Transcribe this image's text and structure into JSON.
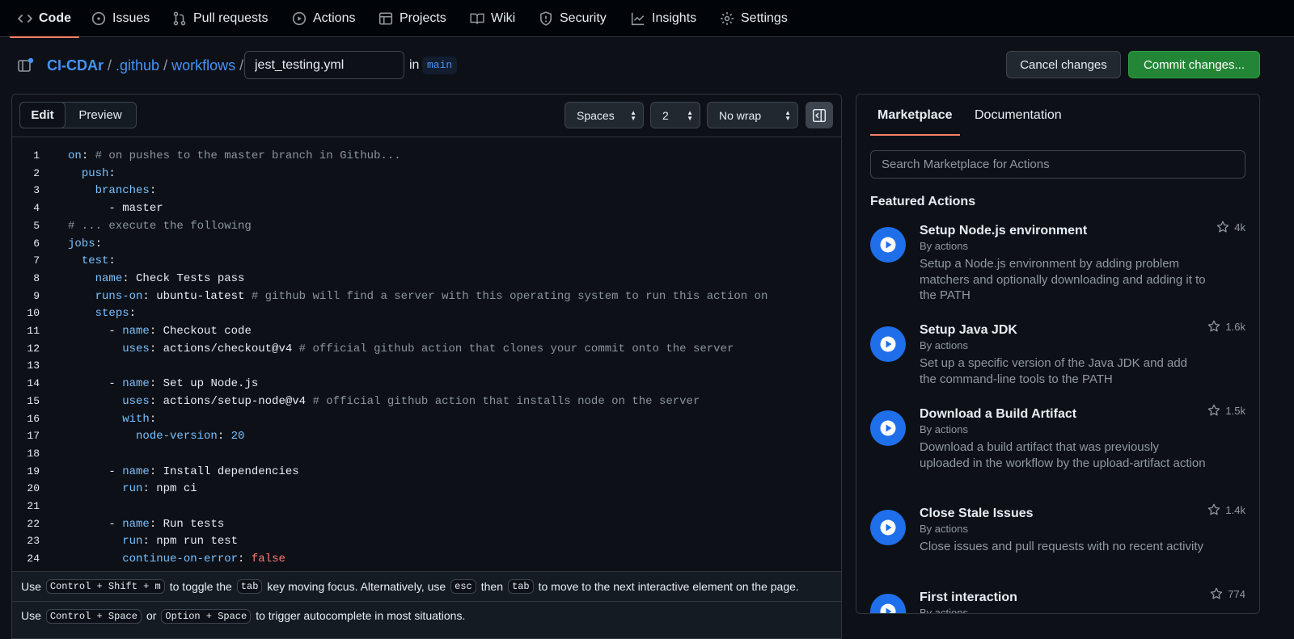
{
  "nav": {
    "items": [
      {
        "label": "Code",
        "icon": "code-icon"
      },
      {
        "label": "Issues",
        "icon": "issue-icon"
      },
      {
        "label": "Pull requests",
        "icon": "pull-request-icon"
      },
      {
        "label": "Actions",
        "icon": "play-icon"
      },
      {
        "label": "Projects",
        "icon": "table-icon"
      },
      {
        "label": "Wiki",
        "icon": "book-icon"
      },
      {
        "label": "Security",
        "icon": "shield-icon"
      },
      {
        "label": "Insights",
        "icon": "graph-icon"
      },
      {
        "label": "Settings",
        "icon": "gear-icon"
      }
    ]
  },
  "breadcrumb": {
    "repo": "CI-CDAr",
    "dir1": ".github",
    "dir2": "workflows",
    "sep": "/",
    "filename": "jest_testing.yml",
    "in_label": "in",
    "branch": "main"
  },
  "buttons": {
    "cancel": "Cancel changes",
    "commit": "Commit changes..."
  },
  "editor": {
    "tabs": {
      "edit": "Edit",
      "preview": "Preview"
    },
    "indent_mode": "Spaces",
    "indent_size": "2",
    "wrap_mode": "No wrap",
    "lines": [
      [
        [
          "k",
          "on"
        ],
        [
          "p",
          ": "
        ],
        [
          "c",
          "# on pushes to the master branch in Github..."
        ]
      ],
      [
        [
          "p",
          "  "
        ],
        [
          "k",
          "push"
        ],
        [
          "p",
          ":"
        ]
      ],
      [
        [
          "p",
          "    "
        ],
        [
          "k",
          "branches"
        ],
        [
          "p",
          ":"
        ]
      ],
      [
        [
          "p",
          "      - master"
        ]
      ],
      [
        [
          "c",
          "# ... execute the following"
        ]
      ],
      [
        [
          "k",
          "jobs"
        ],
        [
          "p",
          ":"
        ]
      ],
      [
        [
          "p",
          "  "
        ],
        [
          "k",
          "test"
        ],
        [
          "p",
          ":"
        ]
      ],
      [
        [
          "p",
          "    "
        ],
        [
          "k",
          "name"
        ],
        [
          "p",
          ": Check Tests pass"
        ]
      ],
      [
        [
          "p",
          "    "
        ],
        [
          "k",
          "runs-on"
        ],
        [
          "p",
          ": ubuntu-latest "
        ],
        [
          "c",
          "# github will find a server with this operating system to run this action on"
        ]
      ],
      [
        [
          "p",
          "    "
        ],
        [
          "k",
          "steps"
        ],
        [
          "p",
          ":"
        ]
      ],
      [
        [
          "p",
          "      - "
        ],
        [
          "k",
          "name"
        ],
        [
          "p",
          ": Checkout code"
        ]
      ],
      [
        [
          "p",
          "        "
        ],
        [
          "k",
          "uses"
        ],
        [
          "p",
          ": actions/checkout@v4 "
        ],
        [
          "c",
          "# official github action that clones your commit onto the server"
        ]
      ],
      [],
      [
        [
          "p",
          "      - "
        ],
        [
          "k",
          "name"
        ],
        [
          "p",
          ": Set up Node.js"
        ]
      ],
      [
        [
          "p",
          "        "
        ],
        [
          "k",
          "uses"
        ],
        [
          "p",
          ": actions/setup-node@v4 "
        ],
        [
          "c",
          "# official github action that installs node on the server"
        ]
      ],
      [
        [
          "p",
          "        "
        ],
        [
          "k",
          "with"
        ],
        [
          "p",
          ":"
        ]
      ],
      [
        [
          "p",
          "          "
        ],
        [
          "k",
          "node-version"
        ],
        [
          "p",
          ": "
        ],
        [
          "n",
          "20"
        ]
      ],
      [],
      [
        [
          "p",
          "      - "
        ],
        [
          "k",
          "name"
        ],
        [
          "p",
          ": Install dependencies"
        ]
      ],
      [
        [
          "p",
          "        "
        ],
        [
          "k",
          "run"
        ],
        [
          "p",
          ": npm ci"
        ]
      ],
      [],
      [
        [
          "p",
          "      - "
        ],
        [
          "k",
          "name"
        ],
        [
          "p",
          ": Run tests"
        ]
      ],
      [
        [
          "p",
          "        "
        ],
        [
          "k",
          "run"
        ],
        [
          "p",
          ": npm run test"
        ]
      ],
      [
        [
          "p",
          "        "
        ],
        [
          "k",
          "continue-on-error"
        ],
        [
          "p",
          ": "
        ],
        [
          "f",
          "false"
        ]
      ]
    ],
    "hint1": {
      "t1": "Use",
      "k1": "Control + Shift + m",
      "t2": "to toggle the",
      "k2": "tab",
      "t3": "key moving focus. Alternatively, use",
      "k3": "esc",
      "t4": "then",
      "k4": "tab",
      "t5": "to move to the next interactive element on the page."
    },
    "hint2": {
      "t1": "Use",
      "k1": "Control + Space",
      "t2": "or",
      "k2": "Option + Space",
      "t3": "to trigger autocomplete in most situations."
    }
  },
  "sidebar": {
    "tabs": {
      "marketplace": "Marketplace",
      "documentation": "Documentation"
    },
    "search_placeholder": "Search Marketplace for Actions",
    "featured_heading": "Featured Actions",
    "actions": [
      {
        "title": "Setup Node.js environment",
        "by": "By actions",
        "desc": "Setup a Node.js environment by adding problem matchers and optionally downloading and adding it to the PATH",
        "stars": "4k"
      },
      {
        "title": "Setup Java JDK",
        "by": "By actions",
        "desc": "Set up a specific version of the Java JDK and add the command-line tools to the PATH",
        "stars": "1.6k"
      },
      {
        "title": "Download a Build Artifact",
        "by": "By actions",
        "desc": "Download a build artifact that was previously uploaded in the workflow by the upload-artifact action",
        "stars": "1.5k"
      },
      {
        "title": "Close Stale Issues",
        "by": "By actions",
        "desc": "Close issues and pull requests with no recent activity",
        "stars": "1.4k"
      },
      {
        "title": "First interaction",
        "by": "By actions",
        "desc": "",
        "stars": "774"
      }
    ]
  },
  "colors": {
    "accent": "#f78166",
    "link": "#4493f8",
    "primary_button": "#238636",
    "action_icon": "#1f6feb"
  }
}
